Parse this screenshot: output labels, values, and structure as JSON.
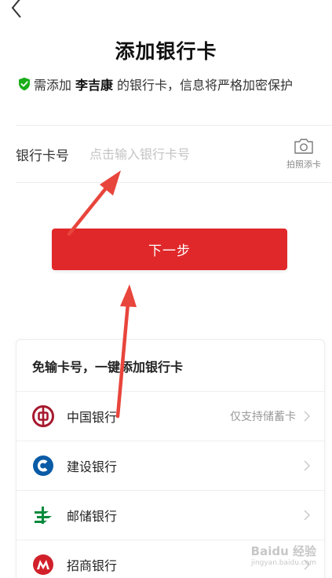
{
  "header": {
    "title": "添加银行卡"
  },
  "notice": {
    "prefix": "需添加",
    "name": "李吉康",
    "suffix": "的银行卡，信息将严格加密保护",
    "icon": "shield-check-icon",
    "icon_color": "#1aad19"
  },
  "card_form": {
    "label": "银行卡号",
    "value": "",
    "placeholder": "点击输入银行卡号",
    "photo_label": "拍照添卡",
    "photo_icon": "camera-icon"
  },
  "next_button": {
    "label": "下一步",
    "color": "#e0282a"
  },
  "quick_add": {
    "title": "免输卡号，一键添加银行卡",
    "banks": [
      {
        "name": "中国银行",
        "note": "仅支持储蓄卡",
        "icon": "boc-logo-icon",
        "color": "#a6192e"
      },
      {
        "name": "建设银行",
        "note": "",
        "icon": "ccb-logo-icon",
        "color": "#0a5ba6"
      },
      {
        "name": "邮储银行",
        "note": "",
        "icon": "psbc-logo-icon",
        "color": "#0a8a3c"
      },
      {
        "name": "招商银行",
        "note": "",
        "icon": "cmb-logo-icon",
        "color": "#d1202a"
      }
    ]
  },
  "watermark": {
    "main": "Baidu 经验",
    "sub": "jingyan.baidu.com"
  },
  "annotation": {
    "arrow_color": "#e8453c"
  }
}
